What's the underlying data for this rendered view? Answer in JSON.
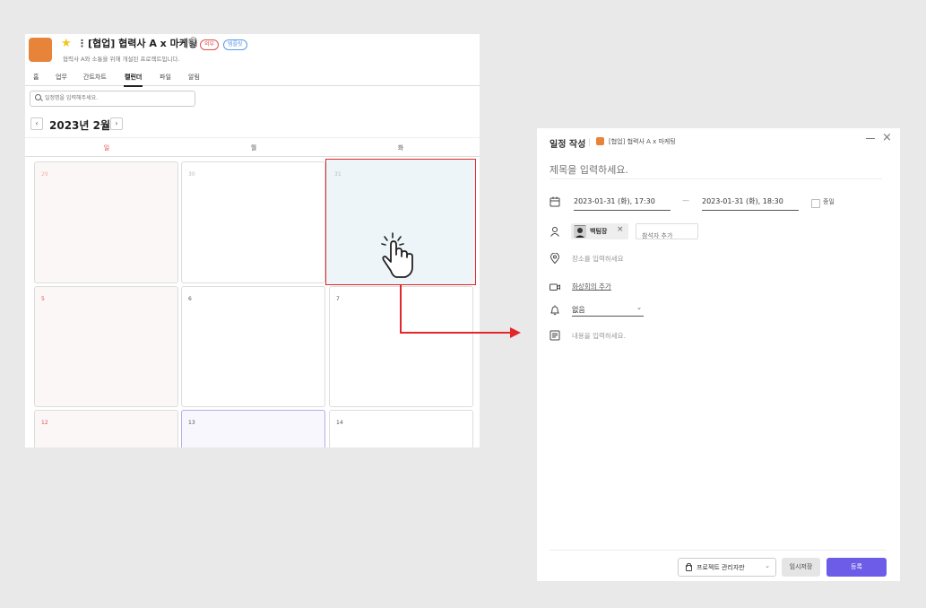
{
  "project": {
    "title": "[협업] 협력사 A x 마케팅",
    "badges": [
      "외부",
      "템플릿"
    ],
    "description": "협력사 A와 소통을 위해 개설된 프로젝트입니다.",
    "color": "#e8833a"
  },
  "tabs": [
    "홈",
    "업무",
    "간트차트",
    "캘린더",
    "파일",
    "알림"
  ],
  "active_tab": "캘린더",
  "search": {
    "placeholder": "일정명을 입력해주세요."
  },
  "calendar": {
    "month_label": "2023년 2월",
    "prev": "‹",
    "next": "›",
    "day_headers": [
      "일",
      "월",
      "화"
    ],
    "weeks": [
      [
        "29",
        "30",
        "31"
      ],
      [
        "5",
        "6",
        "7"
      ],
      [
        "12",
        "13",
        "14"
      ]
    ]
  },
  "modal": {
    "title": "일정 작성",
    "project_name": "[협업] 협력사 A x 마케팅",
    "title_placeholder": "제목을 입력하세요.",
    "start": "2023-01-31 (화), 17:30",
    "dash": "—",
    "end": "2023-01-31 (화), 18:30",
    "allday_label": "종일",
    "attendee": "백팀장",
    "attendee_remove": "×",
    "add_attendee_placeholder": "참석자 추가",
    "location_placeholder": "장소를 입력하세요",
    "video_link": "화상회의 추가",
    "alarm_value": "없음",
    "content_placeholder": "내용을 입력하세요.",
    "visibility": "프로젝트 관리자만",
    "draft_button": "임시저장",
    "submit_button": "등록",
    "close": "×"
  },
  "colors": {
    "accent": "#6c5ce7",
    "highlight": "#e1272a",
    "sunday": "#e35050"
  }
}
